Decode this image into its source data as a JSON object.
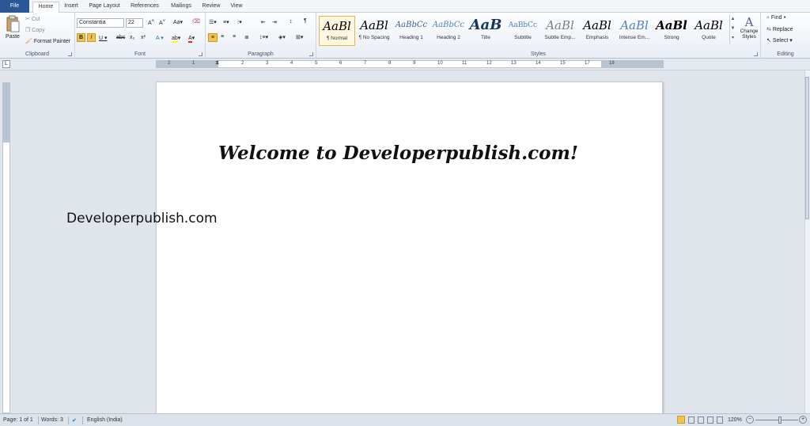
{
  "tabs": {
    "file": "File",
    "items": [
      "Home",
      "Insert",
      "Page Layout",
      "References",
      "Mailings",
      "Review",
      "View"
    ]
  },
  "clipboard": {
    "paste": "Paste",
    "cut": "Cut",
    "copy": "Copy",
    "format_painter": "Format Painter",
    "label": "Clipboard"
  },
  "font": {
    "name": "Constantia",
    "size": "22",
    "label": "Font"
  },
  "paragraph": {
    "label": "Paragraph"
  },
  "styles": {
    "label": "Styles",
    "items": [
      {
        "preview": "AaBl",
        "name": "¶ Normal"
      },
      {
        "preview": "AaBl",
        "name": "¶ No Spacing"
      },
      {
        "preview": "AaBbCc",
        "name": "Heading 1"
      },
      {
        "preview": "AaBbCc",
        "name": "Heading 2"
      },
      {
        "preview": "AaB",
        "name": "Title"
      },
      {
        "preview": "AaBbCc",
        "name": "Subtitle"
      },
      {
        "preview": "AaBl",
        "name": "Subtle Emp..."
      },
      {
        "preview": "AaBl",
        "name": "Emphasis"
      },
      {
        "preview": "AaBl",
        "name": "Intense Em..."
      },
      {
        "preview": "AaBl",
        "name": "Strong"
      },
      {
        "preview": "AaBl",
        "name": "Quote"
      }
    ],
    "change_styles": [
      "Change",
      "Styles"
    ]
  },
  "editing": {
    "find": "Find",
    "replace": "Replace",
    "select": "Select",
    "label": "Editing"
  },
  "ruler": {
    "h_numbers": [
      "2",
      "1",
      "1",
      "2",
      "3",
      "4",
      "5",
      "6",
      "7",
      "8",
      "9",
      "10",
      "11",
      "12",
      "13",
      "14",
      "15",
      "17",
      "18"
    ]
  },
  "document": {
    "heading": "Welcome to Developerpublish.com!",
    "body": "Developerpublish.com"
  },
  "status": {
    "page": "Page: 1 of 1",
    "words": "Words: 3",
    "language": "English (India)",
    "zoom": "120%"
  },
  "colors": {
    "file_tab": "#2b5797",
    "highlight": "#f2c14e",
    "font_color": "#d42a2a"
  }
}
